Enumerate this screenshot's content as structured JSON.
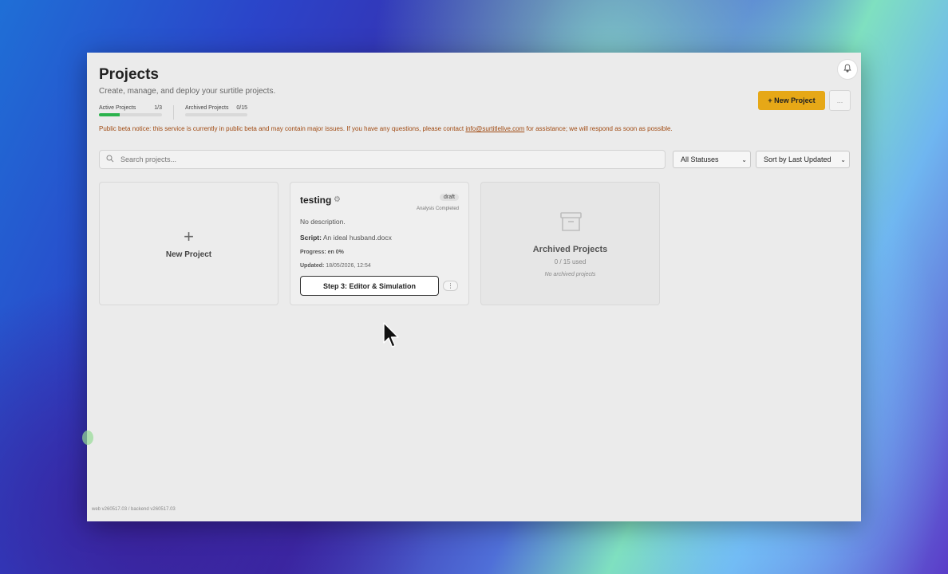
{
  "header": {
    "title": "Projects",
    "subtitle": "Create, manage, and deploy your surtitle projects.",
    "notification_icon": "bell-icon"
  },
  "stats": {
    "active_label": "Active Projects",
    "active_value": "1/3",
    "active_fraction": 0.33,
    "archived_label": "Archived Projects",
    "archived_value": "0/15",
    "archived_fraction": 0
  },
  "notice": {
    "text_before": "Public beta notice: this service is currently in public beta and may contain major issues. If you have any questions, please contact ",
    "email": "info@surtitlelive.com",
    "text_after": " for assistance; we will respond as soon as possible."
  },
  "toolbar": {
    "new_project_label": "+ New Project",
    "more_label": "..."
  },
  "filters": {
    "search_placeholder": "Search projects...",
    "status_value": "All Statuses",
    "sort_value": "Sort by Last Updated"
  },
  "new_card": {
    "icon": "plus-icon",
    "label": "New Project"
  },
  "project": {
    "name": "testing",
    "status_badge": "draft",
    "analysis": "Analysis Completed",
    "description": "No description.",
    "script_label": "Script:",
    "script_value": "An ideal husband.docx",
    "progress_label": "Progress:",
    "progress_value": "en 0%",
    "updated_label": "Updated:",
    "updated_value": "18/05/2026, 12:54",
    "step_button": "Step 3: Editor & Simulation",
    "kebab_label": "⋮"
  },
  "archived_card": {
    "icon": "archive-box-icon",
    "title": "Archived Projects",
    "used": "0 / 15 used",
    "empty": "No archived projects"
  },
  "footer": {
    "version": "web v260517.03 / backend v260517.03"
  },
  "colors": {
    "accent": "#e6a817",
    "progress_green": "#2bb34d",
    "notice": "#a04a12"
  }
}
